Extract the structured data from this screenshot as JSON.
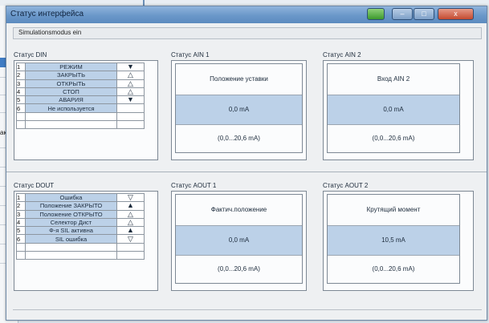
{
  "background": {
    "cut_label": "ак"
  },
  "window": {
    "title": "Статус интерфейса",
    "buttons": {
      "green": "",
      "minimize": "–",
      "maximize": "□",
      "close": "x"
    }
  },
  "menu": {
    "simulation": "Simulationsmodus ein"
  },
  "din": {
    "title": "Статус DIN",
    "rows": [
      {
        "n": "1",
        "label": "РЕЖИМ",
        "icon": "▼"
      },
      {
        "n": "2",
        "label": "ЗАКРЫТЬ",
        "icon": "△"
      },
      {
        "n": "3",
        "label": "ОТКРЫТЬ",
        "icon": "△"
      },
      {
        "n": "4",
        "label": "СТОП",
        "icon": "△"
      },
      {
        "n": "5",
        "label": "АВАРИЯ",
        "icon": "▼"
      },
      {
        "n": "6",
        "label": "Не используется",
        "icon": ""
      }
    ]
  },
  "ain1": {
    "title": "Статус AIN 1",
    "name": "Положение уставки",
    "value": "0,0 mA",
    "range": "(0,0...20,6 mA)"
  },
  "ain2": {
    "title": "Статус AIN 2",
    "name": "Вход AIN 2",
    "value": "0,0 mA",
    "range": "(0,0...20,6 mA)"
  },
  "dout": {
    "title": "Статус DOUT",
    "rows": [
      {
        "n": "1",
        "label": "Ошибка",
        "icon": "▽"
      },
      {
        "n": "2",
        "label": "Положение ЗАКРЫТО",
        "icon": "▲"
      },
      {
        "n": "3",
        "label": "Положение ОТКРЫТО",
        "icon": "△"
      },
      {
        "n": "4",
        "label": "Селектор Дист",
        "icon": "△"
      },
      {
        "n": "5",
        "label": "Ф-я SIL активна",
        "icon": "▲"
      },
      {
        "n": "6",
        "label": "SIL ошибка",
        "icon": "▽"
      }
    ]
  },
  "aout1": {
    "title": "Статус AOUT 1",
    "name": "Фактич.положение",
    "value": "0,0 mA",
    "range": "(0,0...20,6 mA)"
  },
  "aout2": {
    "title": "Статус AOUT 2",
    "name": "Крутящий момент",
    "value": "10,5 mA",
    "range": "(0,0...20,6 mA)"
  }
}
